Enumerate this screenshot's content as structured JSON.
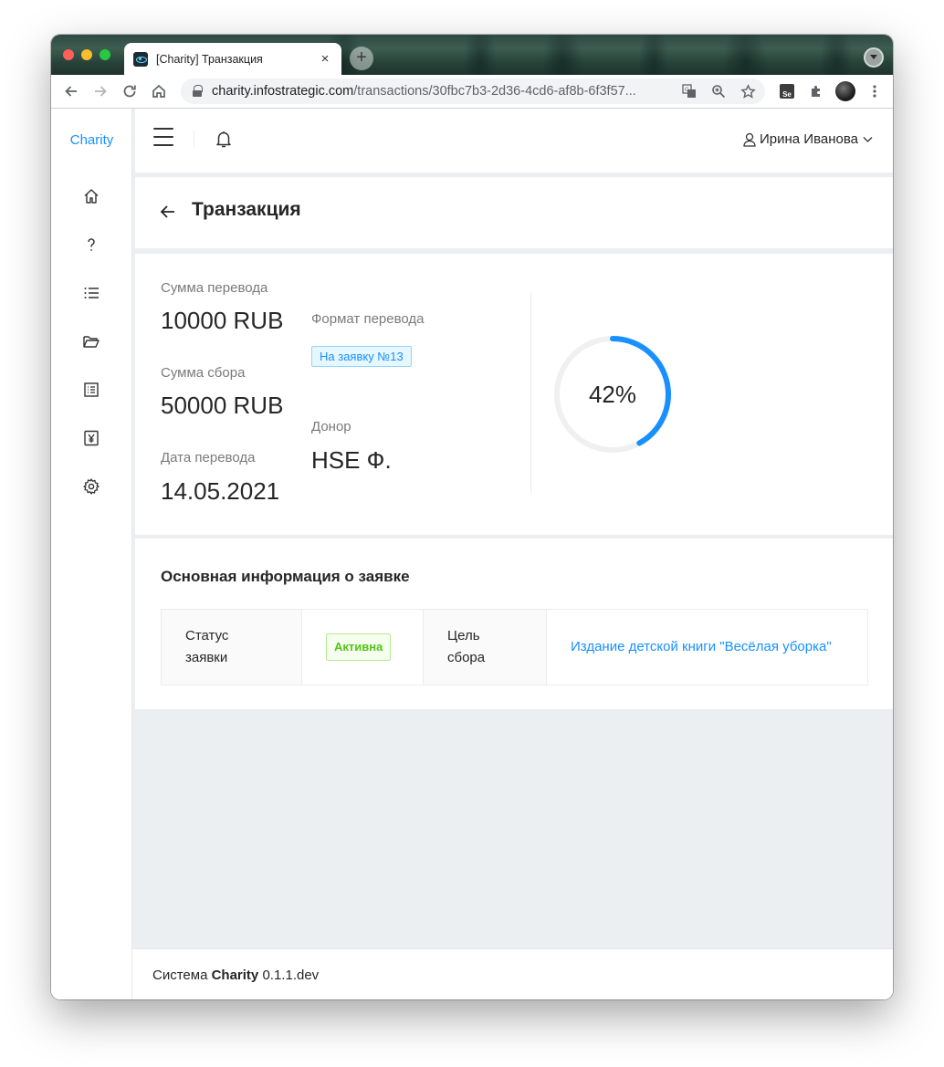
{
  "browser": {
    "tab_title": "[Charity] Транзакция",
    "tab_close": "×",
    "new_tab": "+",
    "url_host": "charity.infostrategic.com",
    "url_path": "/transactions/30fbc7b3-2d36-4cd6-af8b-6f3f57...",
    "icons": [
      "back-icon",
      "forward-icon",
      "reload-icon",
      "home-icon",
      "lock-icon",
      "translate-icon",
      "zoom-icon",
      "star-icon",
      "selenium-extension-icon",
      "extensions-icon",
      "profile-avatar",
      "menu-icon"
    ]
  },
  "sidebar": {
    "brand": "Charity",
    "items": [
      {
        "icon": "home-icon"
      },
      {
        "icon": "question-icon"
      },
      {
        "icon": "list-icon"
      },
      {
        "icon": "folder-open-icon"
      },
      {
        "icon": "document-list-icon"
      },
      {
        "icon": "money-yen-icon"
      },
      {
        "icon": "settings-icon"
      }
    ]
  },
  "header": {
    "user_name": "Ирина Иванова",
    "icons": [
      "menu-burger-icon",
      "bell-icon",
      "user-icon",
      "chevron-down-icon"
    ]
  },
  "page": {
    "title": "Транзакция"
  },
  "stats": {
    "transfer_amount_label": "Сумма перевода",
    "transfer_amount": "10000 RUB",
    "collection_amount_label": "Сумма сбора",
    "collection_amount": "50000 RUB",
    "transfer_date_label": "Дата перевода",
    "transfer_date": "14.05.2021",
    "transfer_format_label": "Формат перевода",
    "transfer_format_tag": "На заявку №13",
    "donor_label": "Донор",
    "donor": "HSE Ф.",
    "progress_percent": 42,
    "progress_text": "42%",
    "progress_color": "#1890ff",
    "progress_track_color": "#f0f0f0"
  },
  "info": {
    "section_title": "Основная информация о заявке",
    "status_label": "Статус заявки",
    "status_value": "Активна",
    "goal_label": "Цель сбора",
    "goal_value": "Издание детской книги \"Весёлая уборка\""
  },
  "footer": {
    "prefix": "Система",
    "name": "Charity",
    "version": "0.1.1.dev"
  },
  "colors": {
    "accent": "#1890ff",
    "success": "#52c41a",
    "background": "#eceff2"
  }
}
